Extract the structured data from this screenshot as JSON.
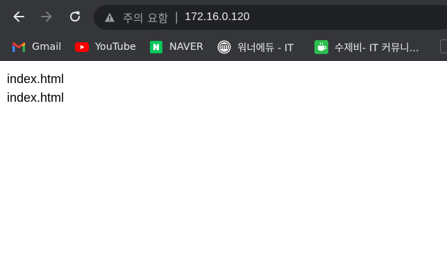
{
  "browser": {
    "security_label": "주의 요함",
    "address_separator": "|",
    "url": "172.16.0.120"
  },
  "bookmarks": [
    {
      "label": "Gmail",
      "icon": "gmail-icon"
    },
    {
      "label": "YouTube",
      "icon": "youtube-icon"
    },
    {
      "label": "NAVER",
      "icon": "naver-icon"
    },
    {
      "label": "워너에듀 - IT",
      "icon": "wannaedu-icon"
    },
    {
      "label": "수제비- IT 커뮤니...",
      "icon": "sujebi-icon"
    }
  ],
  "page": {
    "lines": [
      "index.html",
      "index.html"
    ]
  },
  "colors": {
    "toolbar": "#35363a",
    "omnibox": "#202124",
    "youtube_red": "#ff0000",
    "naver_green": "#03c75a"
  }
}
